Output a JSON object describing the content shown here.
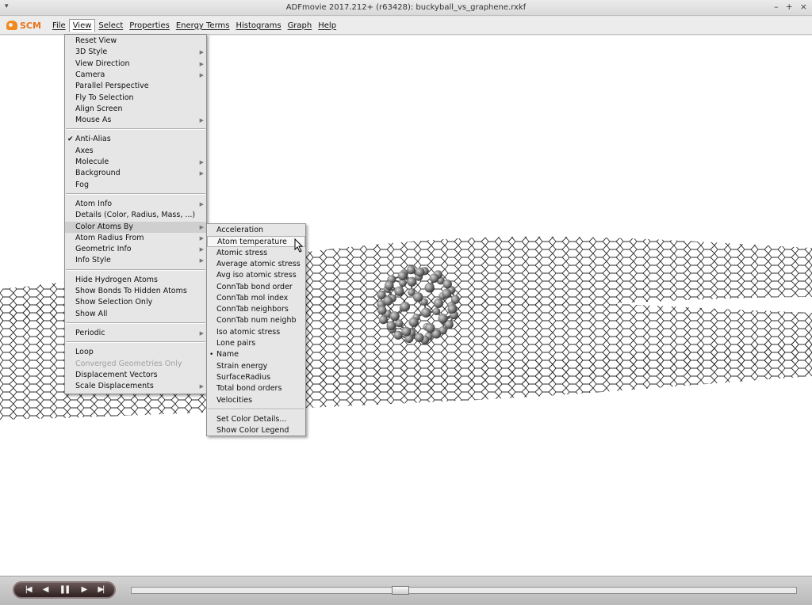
{
  "window": {
    "title": "ADFmovie 2017.212+ (r63428): buckyball_vs_graphene.rxkf",
    "wm_menu_glyph": "▾",
    "wm_buttons": [
      "–",
      "+",
      "×"
    ]
  },
  "menubar": {
    "logo_text": "SCM",
    "items": [
      "File",
      "View",
      "Select",
      "Properties",
      "Energy Terms",
      "Histograms",
      "Graph",
      "Help"
    ]
  },
  "view_menu": {
    "groups": [
      [
        "Reset View",
        "3D Style",
        "View Direction",
        "Camera",
        "Parallel Perspective",
        "Fly To Selection",
        "Align Screen",
        "Mouse As"
      ],
      [
        "Anti-Alias",
        "Axes",
        "Molecule",
        "Background",
        "Fog"
      ],
      [
        "Atom Info",
        "Details (Color, Radius, Mass, ...)",
        "Color Atoms By",
        "Atom Radius From",
        "Geometric Info",
        "Info Style"
      ],
      [
        "Hide Hydrogen Atoms",
        "Show Bonds To Hidden Atoms",
        "Show Selection Only",
        "Show All"
      ],
      [
        "Periodic"
      ],
      [
        "Loop",
        "Converged Geometries Only",
        "Displacement Vectors",
        "Scale Displacements"
      ]
    ],
    "submenu_items": [
      "3D Style",
      "View Direction",
      "Camera",
      "Mouse As",
      "Molecule",
      "Background",
      "Atom Info",
      "Color Atoms By",
      "Atom Radius From",
      "Geometric Info",
      "Info Style",
      "Periodic",
      "Scale Displacements"
    ],
    "checked_item": "Anti-Alias",
    "disabled_item": "Converged Geometries Only",
    "highlighted_item": "Color Atoms By"
  },
  "color_atoms_by_menu": {
    "items": [
      "Acceleration",
      "Atom temperature",
      "Atomic stress",
      "Average atomic stress",
      "Avg iso atomic stress",
      "ConnTab bond order",
      "ConnTab mol index",
      "ConnTab neighbors",
      "ConnTab num neighb",
      "Iso atomic stress",
      "Lone pairs",
      "Name",
      "Strain energy",
      "SurfaceRadius",
      "Total bond orders",
      "Velocities"
    ],
    "footer_items": [
      "Set Color Details...",
      "Show Color Legend"
    ],
    "selected_item": "Name",
    "hovered_item": "Atom temperature"
  },
  "player": {
    "buttons": [
      {
        "name": "first-frame-icon",
        "glyph": "|◀"
      },
      {
        "name": "step-back-icon",
        "glyph": "◀"
      },
      {
        "name": "pause-icon",
        "glyph": "❚❚"
      },
      {
        "name": "play-icon",
        "glyph": "▶"
      },
      {
        "name": "last-frame-icon",
        "glyph": "▶|"
      }
    ]
  },
  "colors": {
    "accent_logo": "#e8741a",
    "mesh": "#2a2a2a",
    "atoms": "#8a8a8a"
  }
}
